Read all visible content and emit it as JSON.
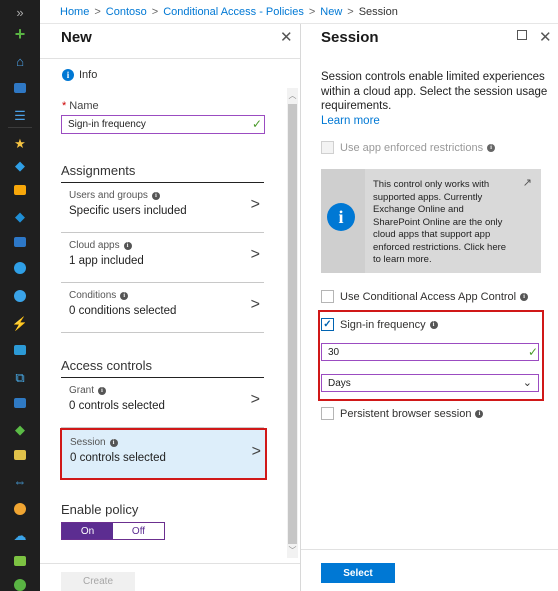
{
  "breadcrumb": {
    "items": [
      "Home",
      "Contoso",
      "Conditional Access - Policies",
      "New",
      "Session"
    ],
    "separator": ">"
  },
  "rail": {
    "expand_glyph": "»",
    "icons": [
      {
        "name": "create-resource-icon",
        "glyph": "+",
        "color": "#59b343"
      },
      {
        "name": "home-icon",
        "glyph": "⌂",
        "color": "#4ba0e6"
      },
      {
        "name": "dashboard-icon",
        "shape": "sq",
        "color": "#2f78c4"
      },
      {
        "name": "all-services-icon",
        "glyph": "☰",
        "color": "#4ba0e6"
      },
      {
        "name": "favorites-star-icon",
        "glyph": "★",
        "color": "#f5c342"
      },
      {
        "name": "resource-groups-icon",
        "glyph": "◆",
        "color": "#2f9fe6"
      },
      {
        "name": "app-services-icon",
        "shape": "sq",
        "color": "#f7a70a"
      },
      {
        "name": "function-apps-icon",
        "glyph": "◆",
        "color": "#1f8fd6"
      },
      {
        "name": "sql-databases-icon",
        "shape": "sq",
        "color": "#2d78c8"
      },
      {
        "name": "cosmos-db-icon",
        "shape": "dot",
        "color": "#2f9fe6"
      },
      {
        "name": "virtual-machines-icon",
        "shape": "dot",
        "color": "#3aa3e8"
      },
      {
        "name": "load-balancers-icon",
        "glyph": "⚡",
        "color": "#d9a02b"
      },
      {
        "name": "storage-accounts-icon",
        "shape": "sq",
        "color": "#2c9ad6"
      },
      {
        "name": "virtual-networks-icon",
        "glyph": "⧉",
        "color": "#49b0f0"
      },
      {
        "name": "azure-ad-icon",
        "shape": "sq",
        "color": "#2f7ac4"
      },
      {
        "name": "monitor-icon",
        "glyph": "◆",
        "color": "#5bbb46"
      },
      {
        "name": "advisor-icon",
        "shape": "sq",
        "color": "#e0c14a"
      },
      {
        "name": "security-center-icon",
        "glyph": "⇔",
        "color": "#4aa8e8"
      },
      {
        "name": "cost-management-icon",
        "shape": "dot",
        "color": "#f0a532"
      },
      {
        "name": "help-support-icon",
        "glyph": "☁",
        "color": "#3aa3e8"
      },
      {
        "name": "lock-icon",
        "shape": "sq",
        "color": "#7cc242"
      },
      {
        "name": "more-icon",
        "shape": "dot",
        "color": "#59b343"
      }
    ]
  },
  "new_blade": {
    "title": "New",
    "close_glyph": "✕",
    "info_label": "Info",
    "name_label": "Name",
    "name_value": "Sign-in frequency",
    "assignments_title": "Assignments",
    "items": [
      {
        "label": "Users and groups",
        "value": "Specific users included"
      },
      {
        "label": "Cloud apps",
        "value": "1 app included"
      },
      {
        "label": "Conditions",
        "value": "0 conditions selected"
      }
    ],
    "access_controls_title": "Access controls",
    "grant": {
      "label": "Grant",
      "value": "0 controls selected"
    },
    "session": {
      "label": "Session",
      "value": "0 controls selected"
    },
    "enable_policy_title": "Enable policy",
    "toggle_on": "On",
    "toggle_off": "Off",
    "create_label": "Create",
    "chevron": ">"
  },
  "session_blade": {
    "title": "Session",
    "close_glyph": "✕",
    "description": "Session controls enable limited experiences within a cloud app. Select the session usage requirements.",
    "learn_more": "Learn more",
    "app_enforced_label": "Use app enforced restrictions",
    "info_box_text": "This control only works with supported apps. Currently Exchange Online and SharePoint Online are the only cloud apps that support app enforced restrictions. Click here to learn more.",
    "cas_label": "Use Conditional Access App Control",
    "signin_freq_label": "Sign-in frequency",
    "signin_freq_value": "30",
    "unit_value": "Days",
    "persistent_label": "Persistent browser session",
    "select_label": "Select"
  },
  "colors": {
    "accent_blue": "#0078d4",
    "purple": "#5c2d91",
    "highlight_red": "#d01818",
    "check_green": "#4a9a2a"
  }
}
